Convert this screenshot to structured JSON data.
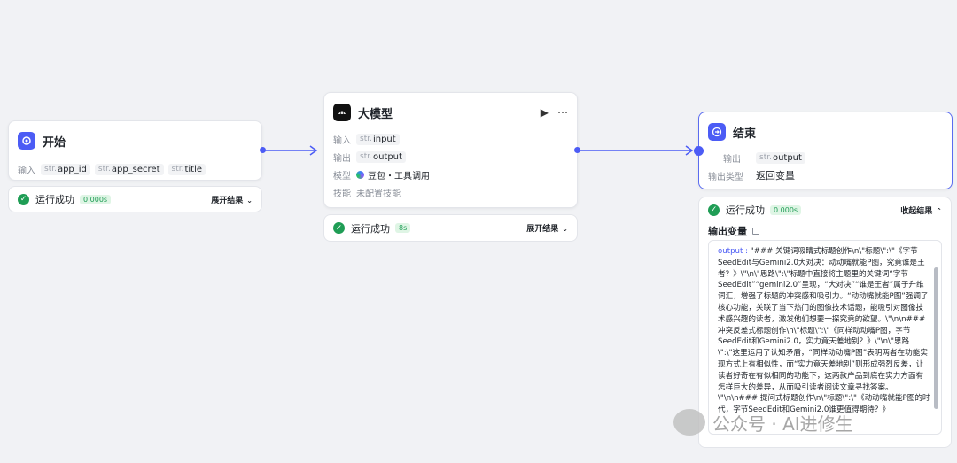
{
  "colors": {
    "accent": "#4c5cf5",
    "success": "#1f9d55",
    "canvas": "#f1f2f5"
  },
  "start_node": {
    "title": "开始",
    "icon": "start-icon",
    "input_label": "输入",
    "type_prefix": "str.",
    "params": [
      "app_id",
      "app_secret",
      "title"
    ],
    "status": "运行成功",
    "duration": "0.000s",
    "expand_label": "展开结果"
  },
  "llm_node": {
    "title": "大模型",
    "icon": "llm-icon",
    "input_label": "输入",
    "input_param": "input",
    "output_label": "输出",
    "output_param": "output",
    "type_prefix": "str.",
    "model_label": "模型",
    "model_value": "豆包・工具调用",
    "skill_label": "技能",
    "skill_value": "未配置技能",
    "status": "运行成功",
    "duration": "8s",
    "expand_label": "展开结果"
  },
  "end_node": {
    "title": "结束",
    "icon": "end-icon",
    "output_label": "输出",
    "output_param": "output",
    "type_prefix": "str.",
    "output_type_label": "输出类型",
    "output_type_value": "返回变量",
    "status": "运行成功",
    "duration": "0.000s",
    "collapse_label": "收起结果",
    "var_heading": "输出变量",
    "output_key": "output",
    "output_text": "\"### 关键词吸睛式标题创作\\n\\\"标题\\\":\\\"《字节SeedEdit与Gemini2.0大对决：动动嘴就能P图，究竟谁是王者？》\\\"\\n\\\"思路\\\":\\\"标题中直接将主题里的关键词“字节SeedEdit”“gemini2.0”呈现，“大对决”“谁是王者”属于升维词汇，增强了标题的冲突感和吸引力。“动动嘴就能P图”强调了核心功能，关联了当下热门的图像技术话题，能吸引对图像技术感兴趣的读者，激发他们想要一探究竟的欲望。\\\"\\n\\n### 冲突反差式标题创作\\n\\\"标题\\\":\\\"《同样动动嘴P图，字节SeedEdit和Gemini2.0，实力竟天差地别？》\\\"\\n\\\"思路\\\":\\\"这里运用了认知矛盾，“同样动动嘴P图”表明两者在功能实现方式上有相似性，而“实力竟天差地别”则形成强烈反差，让读者好奇在有似相同的功能下，这两款产品到底在实力方面有怎样巨大的差异，从而吸引读者阅读文章寻找答案。\\\"\\n\\n### 提问式标题创作\\n\\\"标题\\\":\\\"《动动嘴就能P图的时代，字节SeedEdit和Gemini2.0谁更值得期待？》"
  },
  "watermark": {
    "text": "公众号 · AI进修生"
  }
}
